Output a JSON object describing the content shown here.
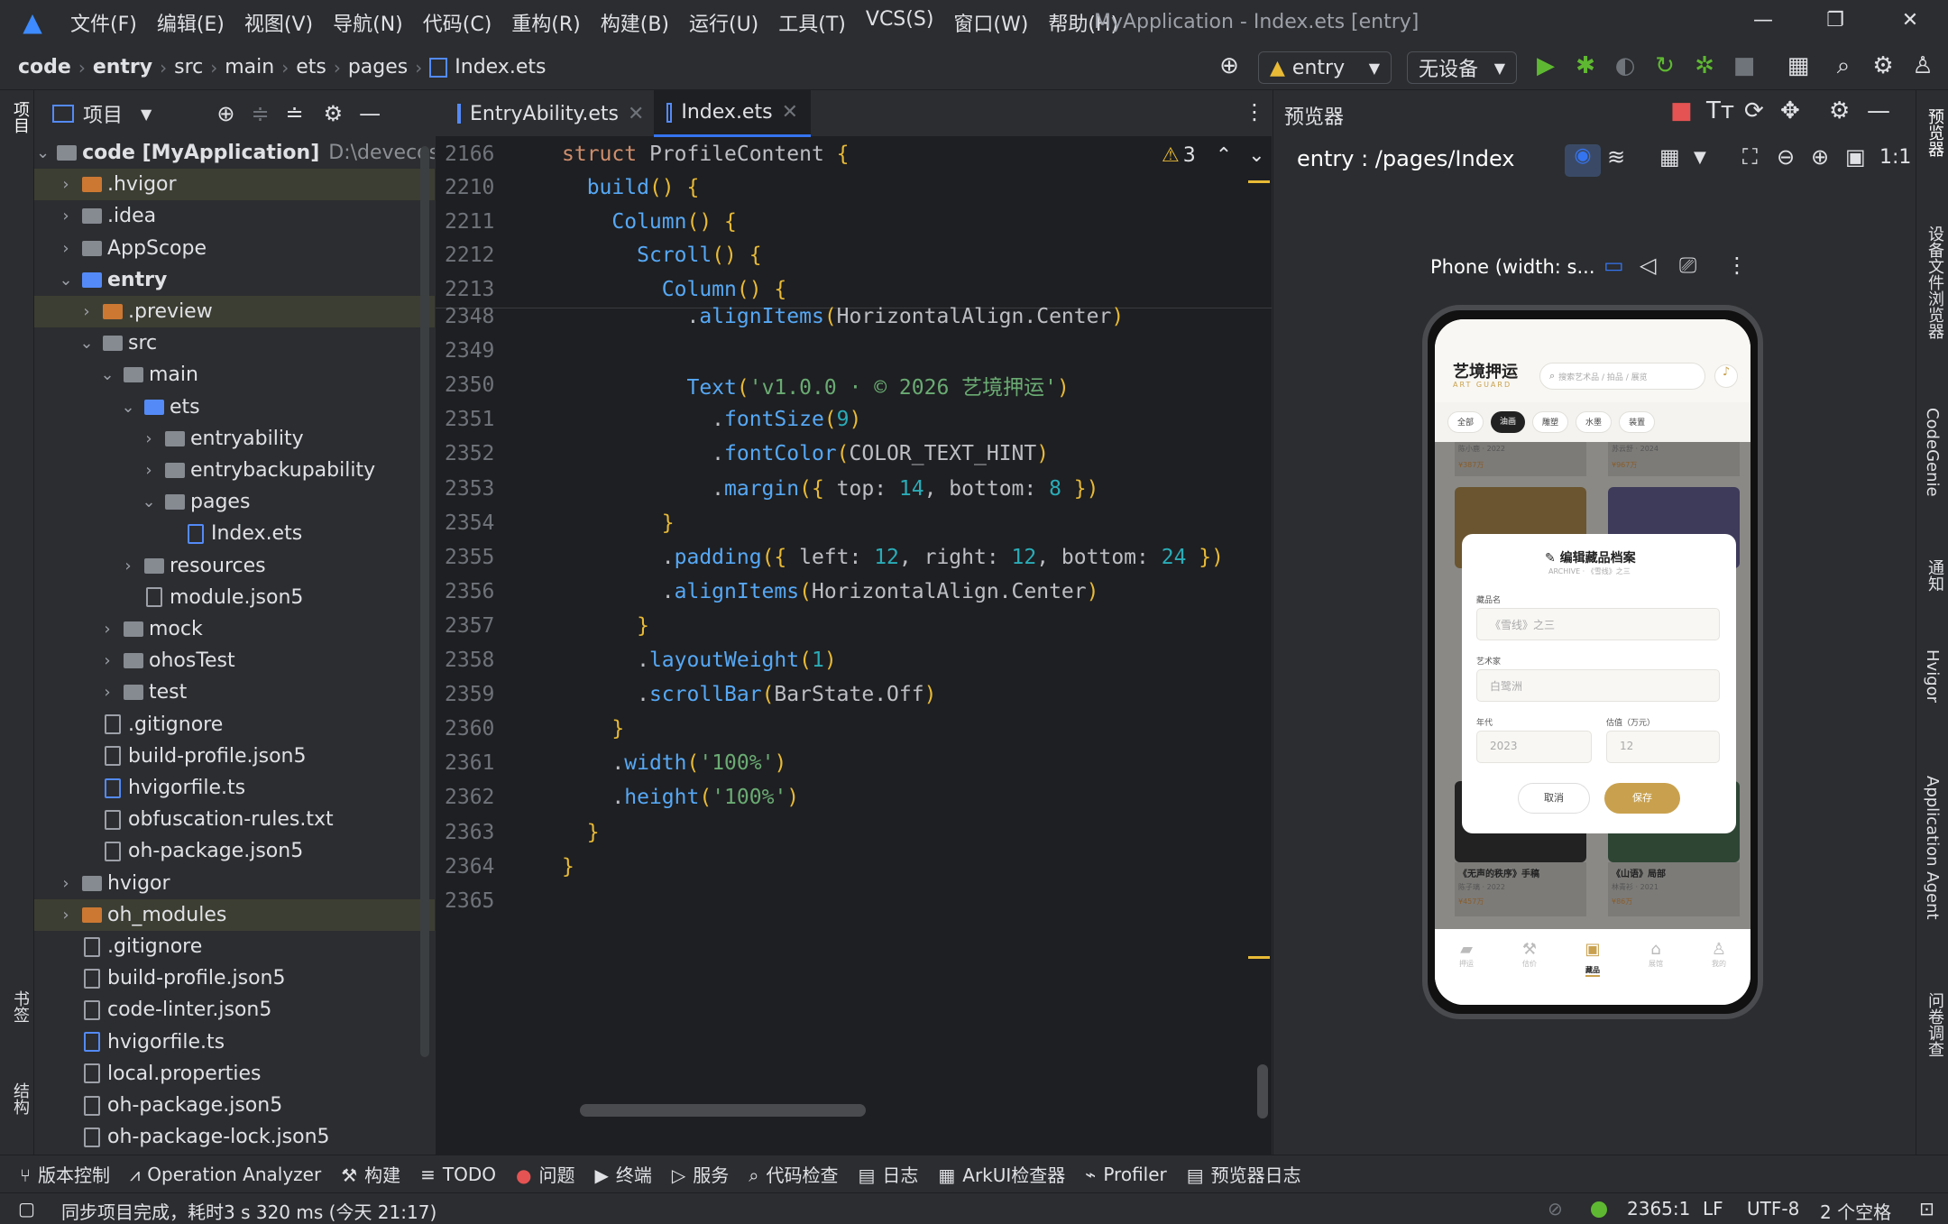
{
  "menubar": {
    "items": [
      "文件(F)",
      "编辑(E)",
      "视图(V)",
      "导航(N)",
      "代码(C)",
      "重构(R)",
      "构建(B)",
      "运行(U)",
      "工具(T)",
      "VCS(S)",
      "窗口(W)",
      "帮助(H)"
    ],
    "title": "MyApplication - Index.ets [entry]"
  },
  "breadcrumb": [
    "code",
    "entry",
    "src",
    "main",
    "ets",
    "pages",
    "Index.ets"
  ],
  "toolbar": {
    "run_config": "entry",
    "device": "无设备"
  },
  "left_strip": {
    "project": "项目",
    "bookmarks": "书签",
    "structure": "结构"
  },
  "project": {
    "title": "项目",
    "rows": [
      {
        "name": "code [MyApplication]",
        "extra": "D:\\devecostu",
        "indent": 0,
        "type": "folder",
        "expanded": true
      },
      {
        "name": ".hvigor",
        "indent": 1,
        "type": "folder-orange",
        "collapsed": true,
        "hl": true
      },
      {
        "name": ".idea",
        "indent": 1,
        "type": "folder",
        "collapsed": true
      },
      {
        "name": "AppScope",
        "indent": 1,
        "type": "folder",
        "collapsed": true
      },
      {
        "name": "entry",
        "indent": 1,
        "type": "folder-blue",
        "expanded": true
      },
      {
        "name": ".preview",
        "indent": 2,
        "type": "folder-orange",
        "collapsed": true,
        "hl": true
      },
      {
        "name": "src",
        "indent": 2,
        "type": "folder",
        "expanded": true
      },
      {
        "name": "main",
        "indent": 3,
        "type": "folder",
        "expanded": true
      },
      {
        "name": "ets",
        "indent": 4,
        "type": "folder-blue",
        "expanded": true
      },
      {
        "name": "entryability",
        "indent": 5,
        "type": "folder",
        "collapsed": true
      },
      {
        "name": "entrybackupability",
        "indent": 5,
        "type": "folder",
        "collapsed": true
      },
      {
        "name": "pages",
        "indent": 5,
        "type": "folder",
        "expanded": true
      },
      {
        "name": "Index.ets",
        "indent": 6,
        "type": "file-ts"
      },
      {
        "name": "resources",
        "indent": 4,
        "type": "folder",
        "collapsed": true
      },
      {
        "name": "module.json5",
        "indent": 4,
        "type": "file"
      },
      {
        "name": "mock",
        "indent": 3,
        "type": "folder",
        "collapsed": true
      },
      {
        "name": "ohosTest",
        "indent": 3,
        "type": "folder",
        "collapsed": true
      },
      {
        "name": "test",
        "indent": 3,
        "type": "folder",
        "collapsed": true
      },
      {
        "name": ".gitignore",
        "indent": 2,
        "type": "file"
      },
      {
        "name": "build-profile.json5",
        "indent": 2,
        "type": "file"
      },
      {
        "name": "hvigorfile.ts",
        "indent": 2,
        "type": "file-ts"
      },
      {
        "name": "obfuscation-rules.txt",
        "indent": 2,
        "type": "file"
      },
      {
        "name": "oh-package.json5",
        "indent": 2,
        "type": "file"
      },
      {
        "name": "hvigor",
        "indent": 1,
        "type": "folder",
        "collapsed": true
      },
      {
        "name": "oh_modules",
        "indent": 1,
        "type": "folder-orange",
        "collapsed": true,
        "hl": true
      },
      {
        "name": ".gitignore",
        "indent": 1,
        "type": "file"
      },
      {
        "name": "build-profile.json5",
        "indent": 1,
        "type": "file"
      },
      {
        "name": "code-linter.json5",
        "indent": 1,
        "type": "file"
      },
      {
        "name": "hvigorfile.ts",
        "indent": 1,
        "type": "file-ts"
      },
      {
        "name": "local.properties",
        "indent": 1,
        "type": "file"
      },
      {
        "name": "oh-package.json5",
        "indent": 1,
        "type": "file"
      },
      {
        "name": "oh-package-lock.json5",
        "indent": 1,
        "type": "file"
      }
    ]
  },
  "editor": {
    "tabs": [
      "EntryAbility.ets",
      "Index.ets"
    ],
    "warnings": "3",
    "sticky": [
      {
        "ln": "2166",
        "code": [
          [
            "kw",
            "struct "
          ],
          [
            "cls",
            "ProfileContent "
          ],
          [
            "brk",
            "{"
          ]
        ]
      },
      {
        "ln": "2210",
        "code": [
          [
            "cls",
            "  "
          ],
          [
            "fn",
            "build"
          ],
          [
            "brk",
            "() {"
          ]
        ]
      },
      {
        "ln": "2211",
        "code": [
          [
            "cls",
            "    "
          ],
          [
            "fn",
            "Column"
          ],
          [
            "brk",
            "() {"
          ]
        ]
      },
      {
        "ln": "2212",
        "code": [
          [
            "cls",
            "      "
          ],
          [
            "fn",
            "Scroll"
          ],
          [
            "brk",
            "() {"
          ]
        ]
      },
      {
        "ln": "2213",
        "code": [
          [
            "cls",
            "        "
          ],
          [
            "fn",
            "Column"
          ],
          [
            "brk",
            "() {"
          ]
        ]
      }
    ],
    "lines": [
      {
        "ln": "2348",
        "code": [
          [
            "cls",
            "          ."
          ],
          [
            "fn",
            "alignItems"
          ],
          [
            "brk",
            "("
          ],
          [
            "cls",
            "HorizontalAlign.Center"
          ],
          [
            "brk",
            ")"
          ]
        ]
      },
      {
        "ln": "2349",
        "code": []
      },
      {
        "ln": "2350",
        "code": [
          [
            "cls",
            "          "
          ],
          [
            "fn",
            "Text"
          ],
          [
            "brk",
            "("
          ],
          [
            "str",
            "'v1.0.0 · © 2026 艺境押运'"
          ],
          [
            "brk",
            ")"
          ]
        ]
      },
      {
        "ln": "2351",
        "code": [
          [
            "cls",
            "            ."
          ],
          [
            "fn",
            "fontSize"
          ],
          [
            "brk",
            "("
          ],
          [
            "num",
            "9"
          ],
          [
            "brk",
            ")"
          ]
        ]
      },
      {
        "ln": "2352",
        "code": [
          [
            "cls",
            "            ."
          ],
          [
            "fn",
            "fontColor"
          ],
          [
            "brk",
            "("
          ],
          [
            "cls",
            "COLOR_TEXT_HINT"
          ],
          [
            "brk",
            ")"
          ]
        ]
      },
      {
        "ln": "2353",
        "code": [
          [
            "cls",
            "            ."
          ],
          [
            "fn",
            "margin"
          ],
          [
            "brk",
            "({ "
          ],
          [
            "cls",
            "top: "
          ],
          [
            "num",
            "14"
          ],
          [
            "cls",
            ", bottom: "
          ],
          [
            "num",
            "8"
          ],
          [
            "brk",
            " })"
          ]
        ]
      },
      {
        "ln": "2354",
        "code": [
          [
            "brk",
            "        }"
          ]
        ]
      },
      {
        "ln": "2355",
        "code": [
          [
            "cls",
            "        ."
          ],
          [
            "fn",
            "padding"
          ],
          [
            "brk",
            "({ "
          ],
          [
            "cls",
            "left: "
          ],
          [
            "num",
            "12"
          ],
          [
            "cls",
            ", right: "
          ],
          [
            "num",
            "12"
          ],
          [
            "cls",
            ", bottom: "
          ],
          [
            "num",
            "24"
          ],
          [
            "brk",
            " })"
          ]
        ]
      },
      {
        "ln": "2356",
        "code": [
          [
            "cls",
            "        ."
          ],
          [
            "fn",
            "alignItems"
          ],
          [
            "brk",
            "("
          ],
          [
            "cls",
            "HorizontalAlign.Center"
          ],
          [
            "brk",
            ")"
          ]
        ]
      },
      {
        "ln": "2357",
        "code": [
          [
            "brk",
            "      }"
          ]
        ]
      },
      {
        "ln": "2358",
        "code": [
          [
            "cls",
            "      ."
          ],
          [
            "fn",
            "layoutWeight"
          ],
          [
            "brk",
            "("
          ],
          [
            "num",
            "1"
          ],
          [
            "brk",
            ")"
          ]
        ]
      },
      {
        "ln": "2359",
        "code": [
          [
            "cls",
            "      ."
          ],
          [
            "fn",
            "scrollBar"
          ],
          [
            "brk",
            "("
          ],
          [
            "cls",
            "BarState.Off"
          ],
          [
            "brk",
            ")"
          ]
        ]
      },
      {
        "ln": "2360",
        "code": [
          [
            "brk",
            "    }"
          ]
        ]
      },
      {
        "ln": "2361",
        "code": [
          [
            "cls",
            "    ."
          ],
          [
            "fn",
            "width"
          ],
          [
            "brk",
            "("
          ],
          [
            "str",
            "'100%'"
          ],
          [
            "brk",
            ")"
          ]
        ]
      },
      {
        "ln": "2362",
        "code": [
          [
            "cls",
            "    ."
          ],
          [
            "fn",
            "height"
          ],
          [
            "brk",
            "("
          ],
          [
            "str",
            "'100%'"
          ],
          [
            "brk",
            ")"
          ]
        ]
      },
      {
        "ln": "2363",
        "code": [
          [
            "brk",
            "  }"
          ]
        ]
      },
      {
        "ln": "2364",
        "code": [
          [
            "brk",
            "}"
          ]
        ]
      },
      {
        "ln": "2365",
        "code": []
      }
    ]
  },
  "preview": {
    "title": "预览器",
    "route": "entry : /pages/Index",
    "device_label": "Phone (width: s..."
  },
  "app": {
    "brand": "艺境押运",
    "brand_en": "ART GUARD",
    "search_placeholder": "搜索艺术品 / 拍品 / 展览",
    "chips": [
      "全部",
      "油画",
      "雕塑",
      "水墨",
      "装置"
    ],
    "top_cards": [
      {
        "sub": "陈小鹿 · 2022",
        "price": "¥387万"
      },
      {
        "sub": "苏云舒 · 2024",
        "price": "¥967万"
      }
    ],
    "bottom_cards": [
      {
        "title": "《无声的秩序》手稿",
        "sub": "陈子璃 · 2022",
        "price": "¥457万"
      },
      {
        "title": "《山语》局部",
        "sub": "林青衫 · 2021",
        "price": "¥86万"
      }
    ],
    "dialog": {
      "title": "编辑藏品档案",
      "subtitle": "ARCHIVE · 《雪线》之三",
      "f_name_label": "藏品名",
      "f_name": "《雪线》之三",
      "f_artist_label": "艺术家",
      "f_artist": "白鹭洲",
      "f_year_label": "年代",
      "f_year": "2023",
      "f_value_label": "估值（万元）",
      "f_value": "12",
      "cancel": "取消",
      "save": "保存"
    },
    "tabbar": [
      "押运",
      "估价",
      "藏品",
      "展馆",
      "我的"
    ]
  },
  "right_strip": [
    "预览器",
    "设备文件浏览器",
    "CodeGenie",
    "通知",
    "Hvigor",
    "Application Agent",
    "问卷调查"
  ],
  "bottom_tools": [
    "版本控制",
    "Operation Analyzer",
    "构建",
    "TODO",
    "问题",
    "终端",
    "服务",
    "代码检查",
    "日志",
    "ArkUI检查器",
    "Profiler",
    "预览器日志"
  ],
  "status": {
    "message": "同步项目完成，耗时3 s 320 ms (今天 21:17)",
    "position": "2365:1",
    "line_sep": "LF",
    "encoding": "UTF-8",
    "indent": "2 个空格"
  },
  "colors": {
    "accent": "#3574f0",
    "run": "#5fb832",
    "stop": "#e55353",
    "gold": "#c9a14e"
  }
}
